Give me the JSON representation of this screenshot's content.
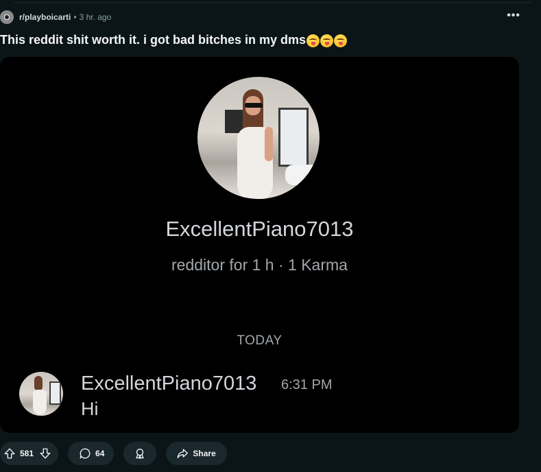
{
  "post": {
    "subreddit": "r/playboicarti",
    "separator": "•",
    "time": "3 hr. ago",
    "more": "•••",
    "title": "This reddit shit worth it. i got bad bitches in my dms"
  },
  "screenshot": {
    "username": "ExcellentPiano7013",
    "user_meta": "redditor for 1 h · 1 Karma",
    "day_label": "TODAY",
    "message": {
      "sender": "ExcellentPiano7013",
      "time": "6:31 PM",
      "text": "Hi"
    }
  },
  "actions": {
    "score": "581",
    "comments": "64",
    "share_label": "Share"
  },
  "colors": {
    "background": "#0b1416",
    "pill": "#1a282d",
    "media_bg": "#000000"
  }
}
